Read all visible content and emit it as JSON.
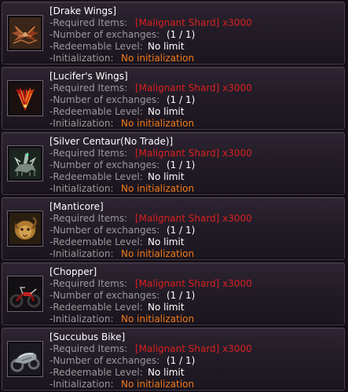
{
  "labels": {
    "required": "-Required Items:",
    "exchanges": "-Number of exchanges:",
    "level": "-Redeemable Level:",
    "init": "-Initialization:"
  },
  "colors": {
    "item_name": "#ffffff",
    "required_value": "#d92020",
    "initialization_value": "#f07a1a",
    "label": "#9a9a9a"
  },
  "items": [
    {
      "name": "[Drake Wings]",
      "icon": "drake-wings-icon",
      "required": "[Malignant Shard] x3000",
      "exchanges": "(1 / 1)",
      "level": "No limit",
      "init": "No initialization"
    },
    {
      "name": "[Lucifer's Wings]",
      "icon": "lucifer-wings-icon",
      "required": "[Malignant Shard] x3000",
      "exchanges": "(1 / 1)",
      "level": "No limit",
      "init": "No initialization"
    },
    {
      "name": "[Silver Centaur(No Trade)]",
      "icon": "silver-centaur-icon",
      "required": "[Malignant Shard] x3000",
      "exchanges": "(1 / 1)",
      "level": "No limit",
      "init": "No initialization"
    },
    {
      "name": "[Manticore]",
      "icon": "manticore-icon",
      "required": "[Malignant Shard] x3000",
      "exchanges": "(1 / 1)",
      "level": "No limit",
      "init": "No initialization"
    },
    {
      "name": "[Chopper]",
      "icon": "chopper-icon",
      "required": "[Malignant Shard] x3000",
      "exchanges": "(1 / 1)",
      "level": "No limit",
      "init": "No initialization"
    },
    {
      "name": "[Succubus Bike]",
      "icon": "succubus-bike-icon",
      "required": "[Malignant Shard] x3000",
      "exchanges": "(1 / 1)",
      "level": "No limit",
      "init": "No initialization"
    }
  ]
}
